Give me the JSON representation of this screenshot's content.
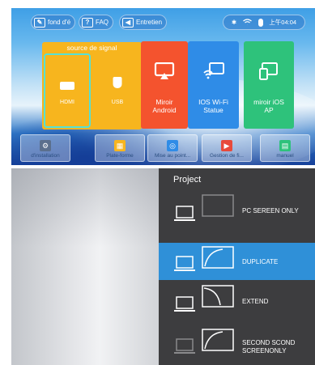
{
  "launcher": {
    "top_buttons": [
      {
        "label": "fond d'é",
        "icon": "edit-icon"
      },
      {
        "label": "FAQ",
        "icon": "help-icon"
      },
      {
        "label": "Entretien",
        "icon": "maintenance-icon"
      }
    ],
    "status": {
      "time": "上午04:04"
    },
    "source_group": {
      "title": "source de signal",
      "items": [
        {
          "label": "HDMI",
          "icon": "hdmi-icon"
        },
        {
          "label": "USB",
          "icon": "usb-icon"
        }
      ]
    },
    "tiles": [
      {
        "label": "Miroir\nAndroid",
        "color": "#f4532e",
        "icon": "android-mirror-icon"
      },
      {
        "label": "IOS Wi-Fi\nStatue",
        "color": "#2f8ce7",
        "icon": "ios-wifi-icon"
      },
      {
        "label": "miroir iOS\nAP",
        "color": "#2ec27b",
        "icon": "ios-ap-icon"
      }
    ],
    "bottom_tiles": [
      {
        "label": "d'installation",
        "icon": "settings-icon",
        "color": "#5b6f8d"
      },
      {
        "label": "Plate-forme",
        "icon": "platform-icon",
        "color": "#f7b51e"
      },
      {
        "label": "Mise au point...",
        "icon": "focus-icon",
        "color": "#2f8ce7"
      },
      {
        "label": "Gestion de fi...",
        "icon": "file-manager-icon",
        "color": "#e84a3b"
      },
      {
        "label": "manuel",
        "icon": "manual-icon",
        "color": "#2ec27b"
      }
    ]
  },
  "project_panel": {
    "title": "Project",
    "options": [
      {
        "label_line1": "PC SEREEN ONLY",
        "label_line2": "",
        "selected": false
      },
      {
        "label_line1": "DUPLICATE",
        "label_line2": "",
        "selected": true
      },
      {
        "label_line1": "EXTEND",
        "label_line2": "",
        "selected": false
      },
      {
        "label_line1": "SECOND     SCOND",
        "label_line2": "SCREENONLY",
        "selected": false
      }
    ]
  }
}
